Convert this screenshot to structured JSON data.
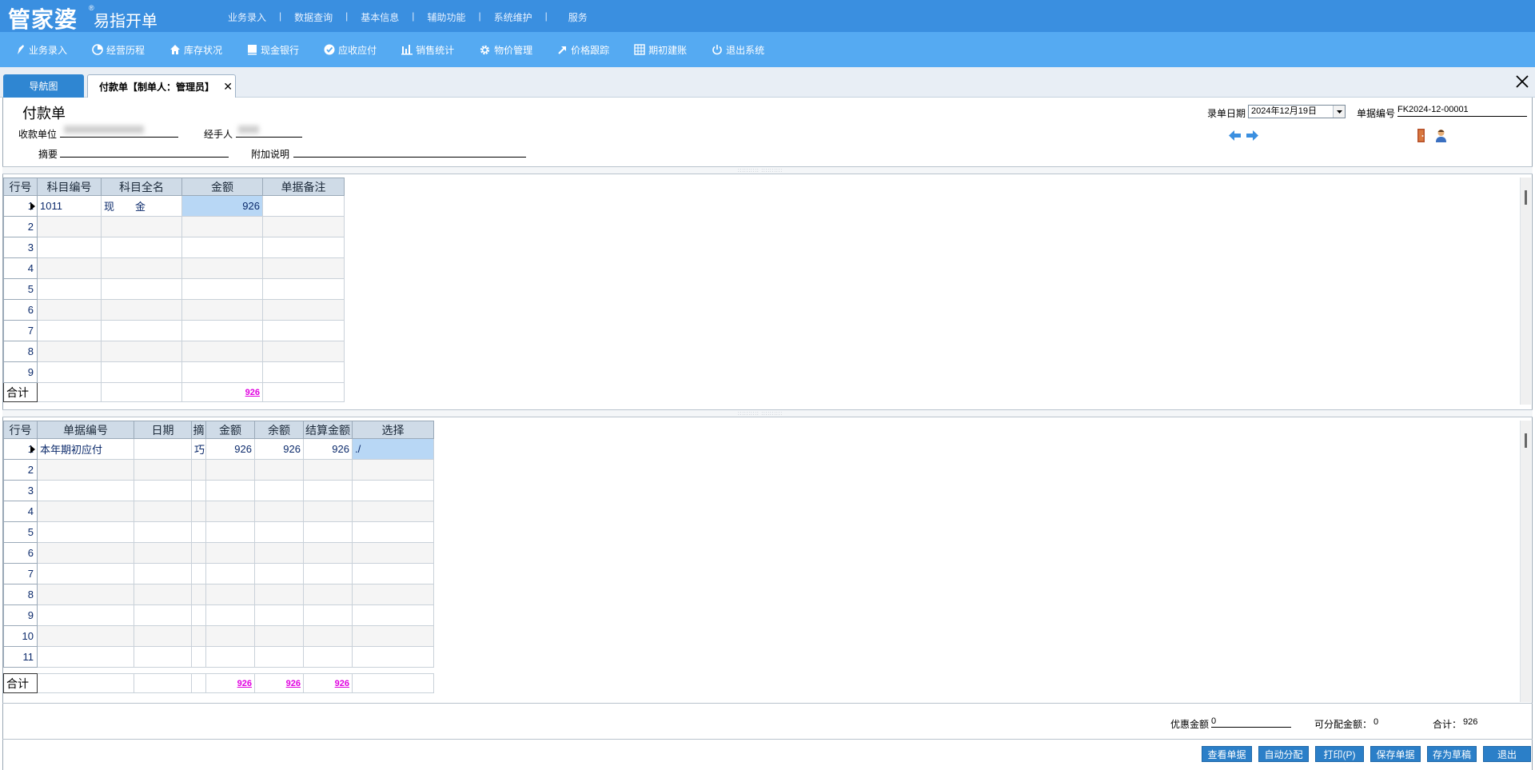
{
  "app": {
    "logo_main": "管家婆",
    "logo_reg": "®",
    "logo_sub": "易指开单"
  },
  "top_menu": [
    "业务录入",
    "数据查询",
    "基本信息",
    "辅助功能",
    "系统维护",
    "服务"
  ],
  "toolbar": [
    {
      "label": "业务录入",
      "icon": "pen-icon"
    },
    {
      "label": "经营历程",
      "icon": "pie-chart-icon"
    },
    {
      "label": "库存状况",
      "icon": "house-icon"
    },
    {
      "label": "现金银行",
      "icon": "book-icon"
    },
    {
      "label": "应收应付",
      "icon": "check-circle-icon"
    },
    {
      "label": "销售统计",
      "icon": "bar-chart-icon"
    },
    {
      "label": "物价管理",
      "icon": "gear-icon"
    },
    {
      "label": "价格跟踪",
      "icon": "arrow-up-right-icon"
    },
    {
      "label": "期初建账",
      "icon": "grid-icon"
    },
    {
      "label": "退出系统",
      "icon": "power-icon"
    }
  ],
  "tabs": {
    "nav": "导航图",
    "doc": "付款单【制单人：管理员】",
    "close": "✕"
  },
  "form": {
    "title": "付款单",
    "payee_label": "收款单位",
    "handler_label": "经手人",
    "summary_label": "摘要",
    "note_label": "附加说明",
    "date_label": "录单日期",
    "date_value": "2024年12月19日",
    "docno_label": "单据编号",
    "docno_value": "FK2024-12-00001"
  },
  "grid1": {
    "headers": [
      "行号",
      "科目编号",
      "科目全名",
      "金额",
      "单据备注"
    ],
    "rows": [
      {
        "no": "1",
        "code": "1011",
        "name": "现　　金",
        "amount": "926",
        "note": ""
      },
      {
        "no": "2"
      },
      {
        "no": "3"
      },
      {
        "no": "4"
      },
      {
        "no": "5"
      },
      {
        "no": "6"
      },
      {
        "no": "7"
      },
      {
        "no": "8"
      },
      {
        "no": "9"
      }
    ],
    "total_label": "合计",
    "total_amount": "926"
  },
  "grid2": {
    "headers": [
      "行号",
      "单据编号",
      "日期",
      "摘",
      "金额",
      "余额",
      "结算金额",
      "选择"
    ],
    "rows": [
      {
        "no": "1",
        "doc": "本年期初应付",
        "date": "",
        "sum": "巧",
        "amount": "926",
        "balance": "926",
        "settle": "926",
        "sel": "./"
      },
      {
        "no": "2"
      },
      {
        "no": "3"
      },
      {
        "no": "4"
      },
      {
        "no": "5"
      },
      {
        "no": "6"
      },
      {
        "no": "7"
      },
      {
        "no": "8"
      },
      {
        "no": "9"
      },
      {
        "no": "10"
      },
      {
        "no": "11"
      }
    ],
    "total_label": "合计",
    "total_amount": "926",
    "total_balance": "926",
    "total_settle": "926"
  },
  "footer": {
    "discount_label": "优惠金额",
    "discount_value": "0",
    "allocatable_label": "可分配金额：",
    "allocatable_value": "0",
    "total_label": "合计：",
    "total_value": "926",
    "buttons": [
      "查看单据",
      "自动分配",
      "打印(P)",
      "保存单据",
      "存为草稿",
      "退出"
    ]
  },
  "colors": {
    "topbar": "#3a8fe0",
    "toolbar": "#55aaf2",
    "button": "#2b7fc8",
    "total_text": "#e000e0"
  }
}
